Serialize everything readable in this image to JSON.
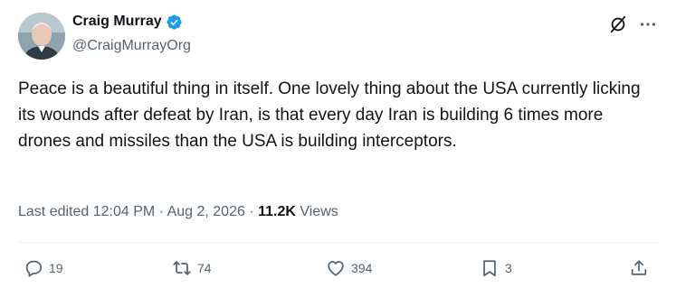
{
  "author": {
    "display_name": "Craig Murray",
    "handle": "@CraigMurrayOrg",
    "verified_icon": "verified-badge-icon",
    "verified_color": "#1d9bf0"
  },
  "tweet": {
    "text": "Peace is a beautiful thing in itself. One lovely thing about the USA currently licking its wounds after defeat by Iran, is that every day Iran is building 6 times more drones and missiles than the USA is building interceptors."
  },
  "meta": {
    "edited_label": "Last edited",
    "time": "12:04 PM",
    "separator": "·",
    "date": "Aug 2, 2026",
    "views_count": "11.2K",
    "views_label": "Views"
  },
  "actions": {
    "reply": {
      "icon": "reply-icon",
      "count": "19"
    },
    "repost": {
      "icon": "repost-icon",
      "count": "74"
    },
    "like": {
      "icon": "heart-icon",
      "count": "394"
    },
    "bookmark": {
      "icon": "bookmark-icon",
      "count": "3"
    },
    "share": {
      "icon": "share-icon"
    }
  },
  "icons": {
    "grok": "grok-icon",
    "more": "more-options-icon"
  },
  "colors": {
    "text_primary": "#0f1419",
    "text_secondary": "#536471",
    "divider": "#eff3f4"
  }
}
